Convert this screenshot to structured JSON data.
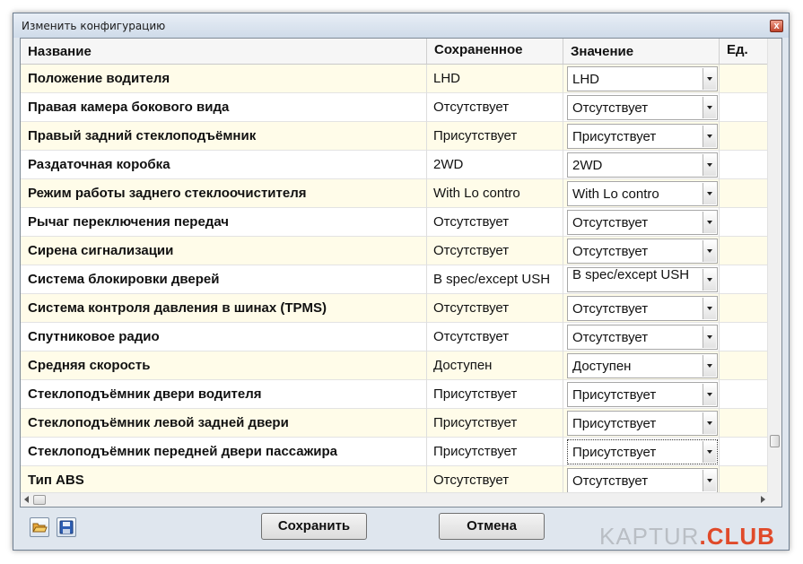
{
  "window": {
    "title": "Изменить конфигурацию",
    "close_glyph": "x"
  },
  "columns": {
    "name": "Название",
    "saved": "Сохраненное",
    "value": "Значение",
    "unit": "Ед."
  },
  "rows": [
    {
      "name": "Положение водителя",
      "saved": "LHD",
      "value": "LHD"
    },
    {
      "name": "Правая камера бокового вида",
      "saved": "Отсутствует",
      "value": "Отсутствует"
    },
    {
      "name": "Правый задний стеклоподъёмник",
      "saved": "Присутствует",
      "value": "Присутствует"
    },
    {
      "name": "Раздаточная коробка",
      "saved": "2WD",
      "value": "2WD"
    },
    {
      "name": "Режим работы заднего стеклоочистителя",
      "saved": "With Lo contro",
      "value": "With Lo contro"
    },
    {
      "name": "Рычаг переключения передач",
      "saved": "Отсутствует",
      "value": "Отсутствует"
    },
    {
      "name": "Сирена сигнализации",
      "saved": "Отсутствует",
      "value": "Отсутствует"
    },
    {
      "name": "Система блокировки дверей",
      "saved": "B spec/except USH",
      "value": "B spec/except USH"
    },
    {
      "name": "Система контроля давления в шинах (TPMS)",
      "saved": "Отсутствует",
      "value": "Отсутствует"
    },
    {
      "name": "Спутниковое радио",
      "saved": "Отсутствует",
      "value": "Отсутствует"
    },
    {
      "name": "Средняя скорость",
      "saved": "Доступен",
      "value": "Доступен"
    },
    {
      "name": "Стеклоподъёмник двери водителя",
      "saved": "Присутствует",
      "value": "Присутствует"
    },
    {
      "name": "Стеклоподъёмник левой задней двери",
      "saved": "Присутствует",
      "value": "Присутствует"
    },
    {
      "name": "Стеклоподъёмник передней двери пассажира",
      "saved": "Присутствует",
      "value": "Присутствует"
    },
    {
      "name": "Тип ABS",
      "saved": "Отсутствует",
      "value": "Отсутствует"
    }
  ],
  "buttons": {
    "save": "Сохранить",
    "cancel": "Отмена"
  },
  "icons": {
    "open": "folder-open-icon",
    "save": "floppy-disk-icon"
  },
  "watermark": {
    "part1": "KAPTUR",
    "part2": ".CLUB"
  },
  "colors": {
    "row_highlight": "#fffce9",
    "accent": "#e04a2a"
  }
}
